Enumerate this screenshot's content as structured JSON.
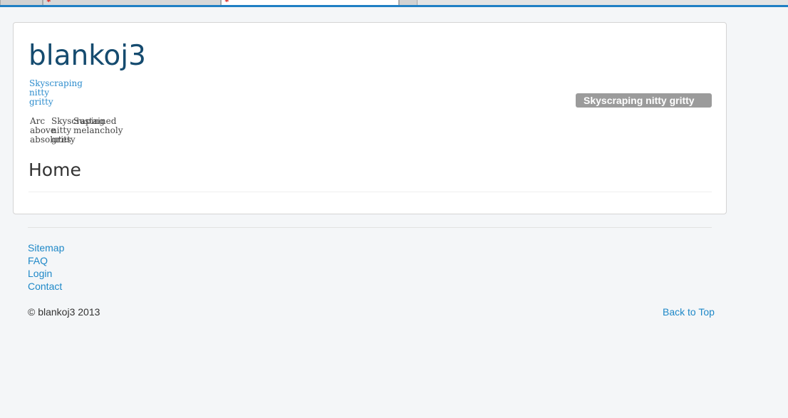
{
  "header": {
    "site_title": "blankoj3",
    "tagline": [
      "Skyscraping",
      "nitty",
      "gritty"
    ]
  },
  "mini_menu": {
    "col1": [
      "Arc",
      "above",
      "absolutes"
    ],
    "col2": [
      "Skyscraping",
      "nitty",
      "gritty"
    ],
    "col3": [
      "Sustained",
      "melancholy"
    ]
  },
  "sidebar_badge": "Skyscraping nitty gritty",
  "main": {
    "page_heading": "Home"
  },
  "footer": {
    "links": [
      "Sitemap",
      "FAQ",
      "Login",
      "Contact"
    ],
    "copyright": "© blankoj3 2013",
    "back_to_top": "Back to Top"
  },
  "colors": {
    "background": "#f4f6f8",
    "title": "#154b6f",
    "link": "#1e88c8",
    "badge": "#9b9b9b",
    "browser_accent": "#1f7fc4"
  }
}
